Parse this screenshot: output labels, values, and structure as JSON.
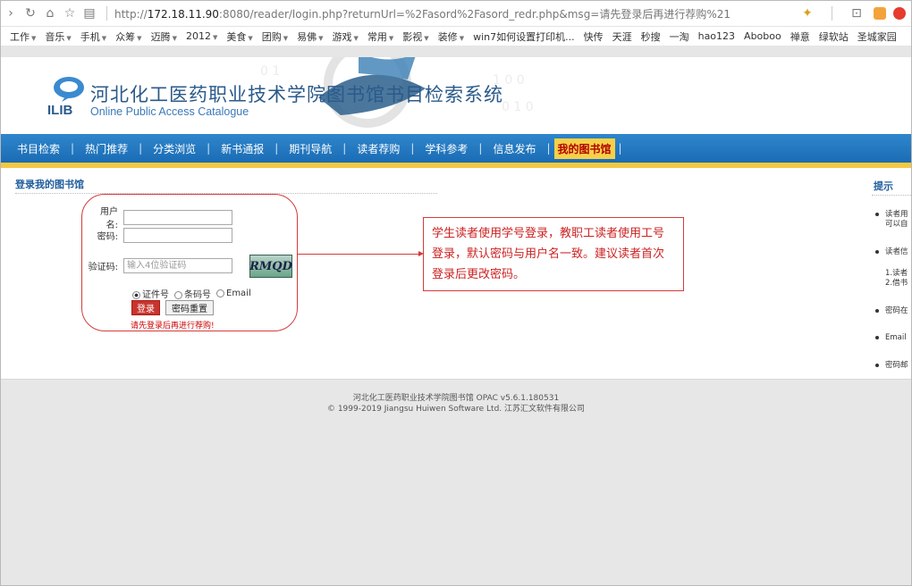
{
  "browser": {
    "url_prefix": "http://",
    "url_host": "172.18.11.90",
    "url_rest": ":8080/reader/login.php?returnUrl=%2Fasord%2Fasord_redr.php&msg=请先登录后再进行荐购%21"
  },
  "bookmarks": [
    "工作",
    "音乐",
    "手机",
    "众筹",
    "迈腾",
    "2012",
    "美食",
    "团购",
    "易佛",
    "游戏",
    "常用",
    "影视",
    "装修",
    "win7如何设置打印机...",
    "快传",
    "天涯",
    "秒搜",
    "一淘",
    "hao123",
    "Aboboo",
    "禅意",
    "绿软站",
    "圣城家园"
  ],
  "site": {
    "logo_text": "ILIB",
    "title": "河北化工医药职业技术学院图书馆书目检索系统",
    "subtitle": "Online Public Access Catalogue"
  },
  "menu": {
    "items": [
      "书目检索",
      "热门推荐",
      "分类浏览",
      "新书通报",
      "期刊导航",
      "读者荐购",
      "学科参考",
      "信息发布"
    ],
    "active": "我的图书馆"
  },
  "login": {
    "section_title": "登录我的图书馆",
    "username_label": "用户名:",
    "password_label": "密码:",
    "captcha_label": "验证码:",
    "captcha_placeholder": "输入4位验证码",
    "captcha_text": "RMQD",
    "radio_options": [
      "证件号",
      "条码号",
      "Email"
    ],
    "login_button": "登录",
    "reset_button": "密码重置",
    "tip": "请先登录后再进行荐购!"
  },
  "annotation": {
    "text": "学生读者使用学号登录，教职工读者使用工号登录，默认密码与用户名一致。建议读者首次登录后更改密码。"
  },
  "hints": {
    "title": "提示",
    "items": [
      "读者用",
      "可以自",
      "读者信",
      "1.读者",
      "2.借书",
      "密码在",
      "Email",
      "密码邮"
    ]
  },
  "footer": {
    "line1": "河北化工医药职业技术学院图书馆   OPAC v5.6.1.180531",
    "line2": "© 1999-2019 Jiangsu Huiwen Software Ltd. 江苏汇文软件有限公司"
  },
  "colors": {
    "menu_blue": "#1a6cb4",
    "accent_yellow": "#f4c842",
    "annotation_red": "#d43b3b"
  }
}
